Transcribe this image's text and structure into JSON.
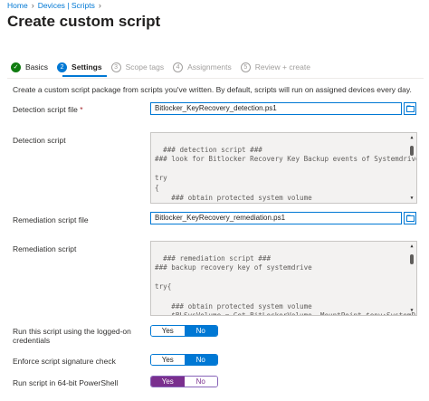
{
  "breadcrumb": {
    "home": "Home",
    "devices_scripts": "Devices | Scripts"
  },
  "page_title": "Create custom script",
  "more_label": "···",
  "steps": [
    {
      "num": "✓",
      "label": "Basics"
    },
    {
      "num": "2",
      "label": "Settings"
    },
    {
      "num": "3",
      "label": "Scope tags"
    },
    {
      "num": "4",
      "label": "Assignments"
    },
    {
      "num": "5",
      "label": "Review + create"
    }
  ],
  "description": "Create a custom script package from scripts you've written. By default, scripts will run on assigned devices every day.",
  "detection_file": {
    "label": "Detection script file",
    "required": "*",
    "value": "Bitlocker_KeyRecovery_detection.ps1"
  },
  "detection_script": {
    "label": "Detection script",
    "text": "### detection script ###\n### look for Bitlocker Recovery Key Backup events of Systemdrive\n\ntry\n{\n    ### obtain protected system volume\n    $BLSysVolume = Get-BitLockerVolume -MountPoint $env:SystemDrive -"
  },
  "remediation_file": {
    "label": "Remediation script file",
    "value": "Bitlocker_KeyRecovery_remediation.ps1"
  },
  "remediation_script": {
    "label": "Remediation script",
    "text": "### remediation script ###\n### backup recovery key of systemdrive\n\ntry{\n\n    ### obtain protected system volume\n    $BLSysVolume = Get-BitLockerVolume -MountPoint $env:SystemDrive"
  },
  "run_logged_on": {
    "label": "Run this script using the logged-on credentials",
    "yes": "Yes",
    "no": "No",
    "selected": "No"
  },
  "enforce_signature": {
    "label": "Enforce script signature check",
    "yes": "Yes",
    "no": "No",
    "selected": "No"
  },
  "run_64bit": {
    "label": "Run script in 64-bit PowerShell",
    "yes": "Yes",
    "no": "No",
    "selected": "Yes"
  },
  "colors": {
    "accent": "#0078d4",
    "success": "#107c10",
    "toggle_purple": "#7a2f8e"
  }
}
